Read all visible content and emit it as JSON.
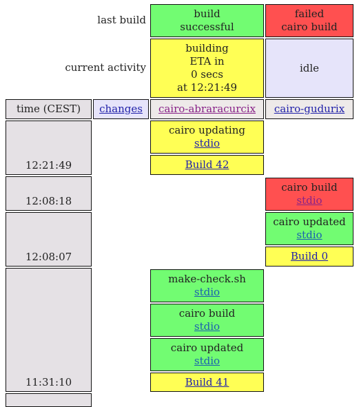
{
  "labels": {
    "last_build": "last build",
    "current_activity": "current activity"
  },
  "last_build": {
    "abraracurcix": [
      "build",
      "successful"
    ],
    "gudurix": [
      "failed",
      "cairo build"
    ]
  },
  "current_activity": {
    "abraracurcix": [
      "building",
      "ETA in",
      "0 secs",
      "at 12:21:49"
    ],
    "gudurix": "idle"
  },
  "headers": {
    "time": "time (CEST)",
    "changes": "changes",
    "builder1": "cairo-abraracurcix",
    "builder2": "cairo-gudurix"
  },
  "times": [
    "12:21:49",
    "12:08:18",
    "12:08:07",
    "11:31:10"
  ],
  "events": {
    "e1": {
      "title": "cairo updating",
      "link": "stdio"
    },
    "e2": {
      "link": "Build 42"
    },
    "e3": {
      "title": "cairo build",
      "link": "stdio"
    },
    "e4": {
      "title": "cairo updated",
      "link": "stdio"
    },
    "e5": {
      "link": "Build 0"
    },
    "e6": {
      "title": "make-check.sh",
      "link": "stdio"
    },
    "e7": {
      "title": "cairo build",
      "link": "stdio"
    },
    "e8": {
      "title": "cairo updated",
      "link": "stdio"
    },
    "e9": {
      "link": "Build 41"
    }
  },
  "colors": {
    "success": "#72fc72",
    "failure": "#ff5050",
    "building": "#ffff55",
    "idle": "#e6e4fa"
  }
}
